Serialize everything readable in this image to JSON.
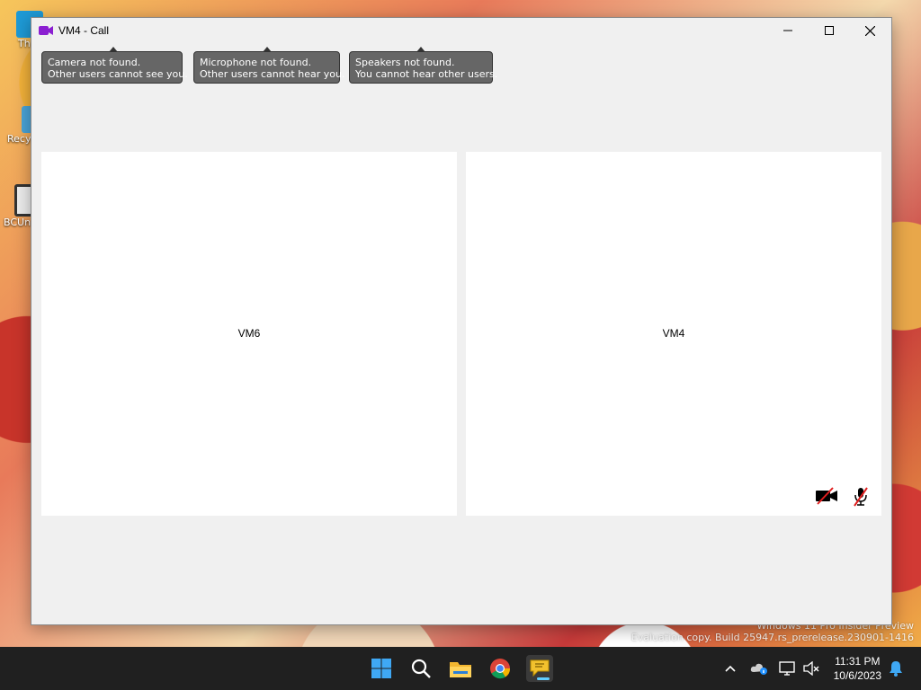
{
  "desktop": {
    "icons": [
      {
        "label": "Th"
      },
      {
        "label": "Recy"
      },
      {
        "label": "BCUn"
      }
    ],
    "watermark_line1": "Windows 11 Pro Insider Preview",
    "watermark_line2": "Evaluation copy. Build 25947.rs_prerelease.230901-1416"
  },
  "window": {
    "title": "VM4 - Call",
    "buttons": {
      "minimize": "minimize",
      "maximize": "maximize",
      "close": "close"
    }
  },
  "notifications": [
    {
      "line1": "Camera not found.",
      "line2": "Other users cannot see you."
    },
    {
      "line1": "Microphone not found.",
      "line2": "Other users cannot hear you."
    },
    {
      "line1": "Speakers not found.",
      "line2": "You cannot hear other users."
    }
  ],
  "panes": {
    "remote": {
      "name": "VM6"
    },
    "local": {
      "name": "VM4",
      "camera_state": "off",
      "mic_state": "off"
    }
  },
  "taskbar": {
    "apps": [
      "start-icon",
      "search-icon",
      "file-explorer-icon",
      "chrome-icon",
      "chat-app-icon"
    ],
    "clock_time": "11:31 PM",
    "clock_date": "10/6/2023"
  },
  "colors": {
    "title_icon": "#8b1fd1",
    "tooltip_bg": "#666666",
    "mute_slash": "#e01e1e"
  }
}
